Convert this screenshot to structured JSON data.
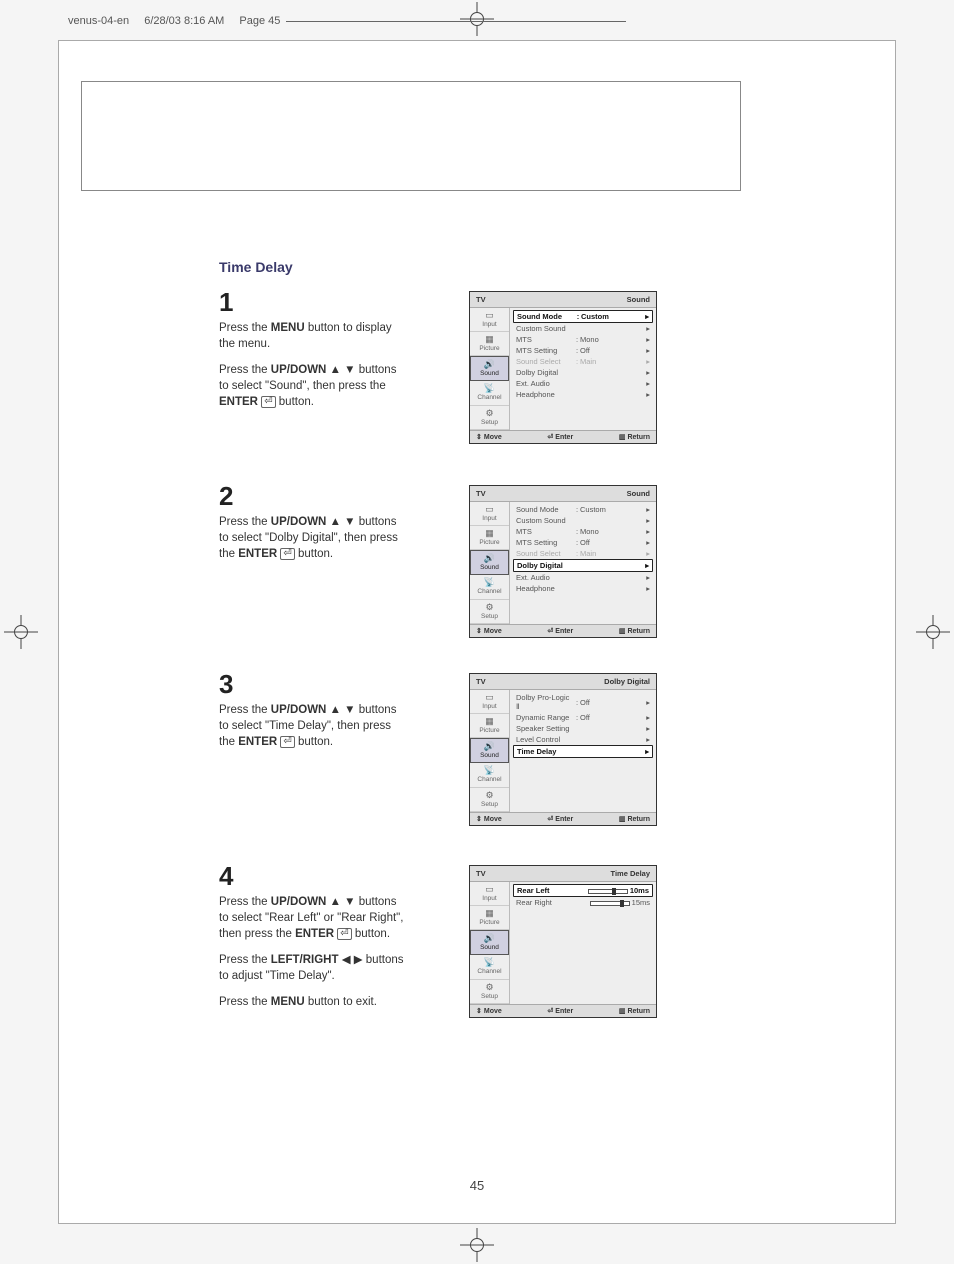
{
  "print_header": {
    "doc": "venus-04-en",
    "datetime": "6/28/03 8:16 AM",
    "page_ref": "Page 45"
  },
  "section_title": "Time Delay",
  "page_number": "45",
  "footer": {
    "move": "Move",
    "enter": "Enter",
    "return": "Return"
  },
  "nav": {
    "input": "Input",
    "picture": "Picture",
    "sound": "Sound",
    "channel": "Channel",
    "setup": "Setup"
  },
  "steps": [
    {
      "num": "1",
      "paragraphs": [
        "Press the <b>MENU</b> button to display the menu.",
        "Press the <b>UP/DOWN</b> ▲ ▼ buttons to select \"Sound\", then press the <b>ENTER</b> <span class='enter-glyph'>⏎</span> button."
      ],
      "menu": {
        "title_left": "TV",
        "title_right": "Sound",
        "nav_sel": "sound",
        "highlight": 0,
        "rows": [
          {
            "label": "Sound Mode",
            "value": "Custom"
          },
          {
            "label": "Custom Sound",
            "value": ""
          },
          {
            "label": "MTS",
            "value": "Mono"
          },
          {
            "label": "MTS Setting",
            "value": "Off"
          },
          {
            "label": "Sound Select",
            "value": "Main",
            "dim": true
          },
          {
            "label": "Dolby Digital",
            "value": ""
          },
          {
            "label": "Ext. Audio",
            "value": ""
          },
          {
            "label": "Headphone",
            "value": ""
          }
        ]
      }
    },
    {
      "num": "2",
      "paragraphs": [
        "Press the <b>UP/DOWN</b> ▲ ▼ buttons to select \"Dolby Digital\", then press the <b>ENTER</b> <span class='enter-glyph'>⏎</span> button."
      ],
      "menu": {
        "title_left": "TV",
        "title_right": "Sound",
        "nav_sel": "sound",
        "highlight": 5,
        "rows": [
          {
            "label": "Sound Mode",
            "value": "Custom"
          },
          {
            "label": "Custom Sound",
            "value": ""
          },
          {
            "label": "MTS",
            "value": "Mono"
          },
          {
            "label": "MTS Setting",
            "value": "Off"
          },
          {
            "label": "Sound Select",
            "value": "Main",
            "dim": true
          },
          {
            "label": "Dolby Digital",
            "value": ""
          },
          {
            "label": "Ext. Audio",
            "value": ""
          },
          {
            "label": "Headphone",
            "value": ""
          }
        ]
      }
    },
    {
      "num": "3",
      "paragraphs": [
        "Press the <b>UP/DOWN</b> ▲ ▼ buttons to select \"Time Delay\", then press the <b>ENTER</b> <span class='enter-glyph'>⏎</span> button."
      ],
      "menu": {
        "title_left": "TV",
        "title_right": "Dolby Digital",
        "nav_sel": "sound",
        "highlight": 4,
        "rows": [
          {
            "label": "Dolby Pro-Logic Ⅱ",
            "value": "Off"
          },
          {
            "label": "Dynamic Range",
            "value": "Off"
          },
          {
            "label": "Speaker Setting",
            "value": ""
          },
          {
            "label": "Level Control",
            "value": ""
          },
          {
            "label": "Time Delay",
            "value": ""
          }
        ]
      }
    },
    {
      "num": "4",
      "paragraphs": [
        "Press the <b>UP/DOWN</b> ▲ ▼ buttons to select \"Rear Left\" or \"Rear Right\", then press the <b>ENTER</b> <span class='enter-glyph'>⏎</span>  button.",
        "Press the <b>LEFT/RIGHT</b> ◀ ▶ buttons to adjust \"Time Delay\".",
        "Press the <b>MENU</b> button to exit."
      ],
      "menu": {
        "title_left": "TV",
        "title_right": "Time Delay",
        "nav_sel": "sound",
        "highlight": 0,
        "rows": [
          {
            "label": "Rear Left",
            "value": "10ms",
            "slider": 60
          },
          {
            "label": "Rear Right",
            "value": "15ms",
            "slider": 78
          }
        ]
      }
    }
  ]
}
